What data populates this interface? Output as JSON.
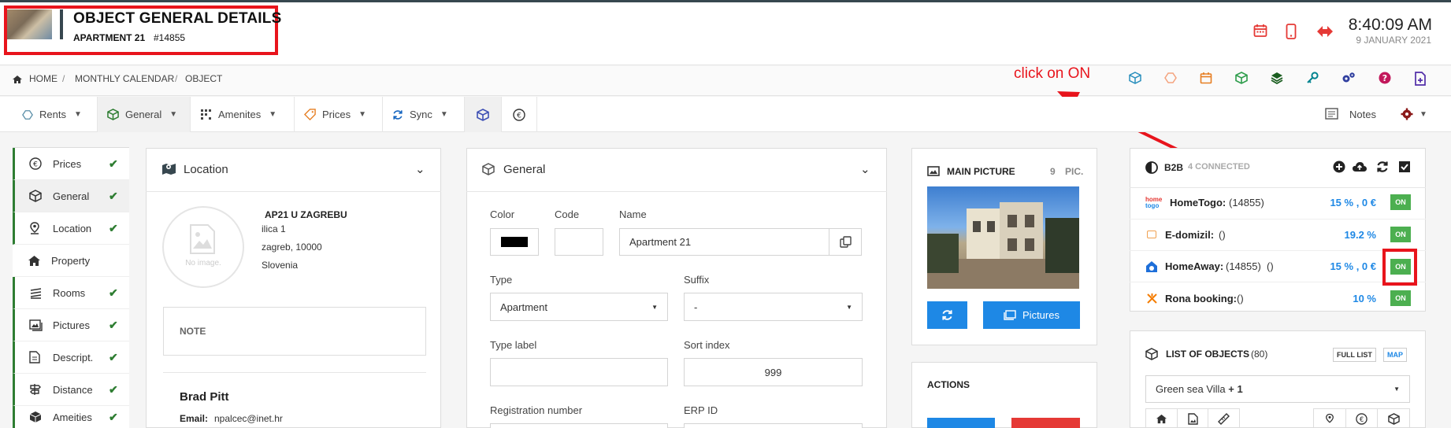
{
  "header": {
    "title": "OBJECT GENERAL DETAILS",
    "subtitle": "APARTMENT 21",
    "object_id": "#14855",
    "time": "8:40:09 AM",
    "date": "9 JANUARY 2021"
  },
  "breadcrumb": [
    "HOME",
    "/",
    "MONTHLY CALENDAR",
    "/",
    "OBJECT"
  ],
  "annotation": "click on ON",
  "tabs": [
    {
      "label": "Rents"
    },
    {
      "label": "General"
    },
    {
      "label": "Amenites"
    },
    {
      "label": "Prices"
    },
    {
      "label": "Sync"
    }
  ],
  "notes_label": "Notes",
  "sidenav": [
    {
      "label": "Prices",
      "done": "✔"
    },
    {
      "label": "General",
      "done": "✔"
    },
    {
      "label": "Location",
      "done": "✔"
    },
    {
      "label": "Property",
      "done": ""
    },
    {
      "label": "Rooms",
      "done": "✔"
    },
    {
      "label": "Pictures",
      "done": "✔"
    },
    {
      "label": "Descript.",
      "done": "✔"
    },
    {
      "label": "Distance",
      "done": "✔"
    },
    {
      "label": "Ameities",
      "done": "✔"
    }
  ],
  "location": {
    "heading": "Location",
    "no_image": "No image.",
    "name": "AP21 U ZAGREBU",
    "street": "ilica 1",
    "city": "zagreb, 10000",
    "country": "Slovenia",
    "note_label": "NOTE",
    "owner": "Brad Pitt",
    "email_label": "Email:",
    "email": "npalcec@inet.hr"
  },
  "general": {
    "heading": "General",
    "color_label": "Color",
    "color_value": "#000000",
    "code_label": "Code",
    "code_value": "",
    "name_label": "Name",
    "name_value": "Apartment 21",
    "type_label": "Type",
    "type_value": "Apartment",
    "suffix_label": "Suffix",
    "suffix_value": "-",
    "type_label_label": "Type label",
    "type_label_value": "",
    "sort_index_label": "Sort index",
    "sort_index_value": "999",
    "reg_label": "Registration number",
    "erp_label": "ERP ID"
  },
  "main_picture": {
    "heading": "MAIN PICTURE",
    "count": "9",
    "count_unit": "PIC.",
    "pictures_button": "Pictures"
  },
  "actions": {
    "heading": "ACTIONS"
  },
  "b2b": {
    "heading": "B2B",
    "connected": "4 CONNECTED",
    "rows": [
      {
        "name": "HomeTogo:",
        "extra": "(14855)",
        "value": "15 % , 0 €",
        "status": "ON"
      },
      {
        "name": "E-domizil:",
        "extra": "()",
        "value": "19.2 %",
        "status": "ON"
      },
      {
        "name": "HomeAway:",
        "extra": "(14855)  ()",
        "value": "15 % , 0 €",
        "status": "ON"
      },
      {
        "name": "Rona booking:",
        "extra": "()",
        "value": "10 %",
        "status": "ON"
      }
    ]
  },
  "list_objects": {
    "heading": "LIST OF OBJECTS",
    "count": "(80)",
    "full_list": "FULL LIST",
    "map": "MAP",
    "selected": "Green sea Villa",
    "selected_extra": "+ 1"
  },
  "colors": {
    "accent": "#1e88e5",
    "success": "#4caf50",
    "highlight": "#e8141c",
    "header_dark": "#37474f"
  }
}
